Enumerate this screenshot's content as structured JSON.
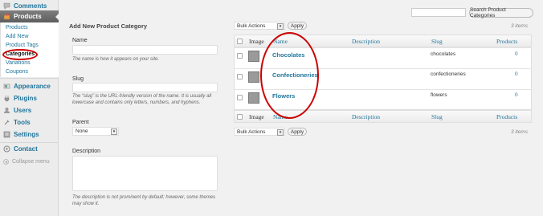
{
  "sidebar": {
    "comments": "Comments",
    "products": "Products",
    "products_sub": [
      "Products",
      "Add New",
      "Product Tags",
      "Categories",
      "Variations",
      "Coupons"
    ],
    "appearance": "Appearance",
    "plugins": "Plugins",
    "users": "Users",
    "tools": "Tools",
    "settings": "Settings",
    "contact": "Contact",
    "collapse": "Collapse menu"
  },
  "form": {
    "heading": "Add New Product Category",
    "name_label": "Name",
    "name_desc": "The name is how it appears on your site.",
    "slug_label": "Slug",
    "slug_desc": "The “slug” is the URL-friendly version of the name. It is usually all lowercase and contains only letters, numbers, and hyphens.",
    "parent_label": "Parent",
    "parent_value": "None",
    "description_label": "Description",
    "description_desc": "The description is not prominent by default; however, some themes may show it."
  },
  "table": {
    "search_button": "Search Product Categories",
    "bulk_actions": "Bulk Actions",
    "apply": "Apply",
    "items_count": "3 items",
    "columns": {
      "image": "Image",
      "name": "Name",
      "description": "Description",
      "slug": "Slug",
      "products": "Products"
    },
    "rows": [
      {
        "name": "Chocolates",
        "slug": "chocolates",
        "count": "0"
      },
      {
        "name": "Confectioneries",
        "slug": "confectioneries",
        "count": "0"
      },
      {
        "name": "Flowers",
        "slug": "flowers",
        "count": "0"
      }
    ]
  },
  "colors": {
    "accent": "#21759b",
    "annotation": "#cc0000"
  }
}
